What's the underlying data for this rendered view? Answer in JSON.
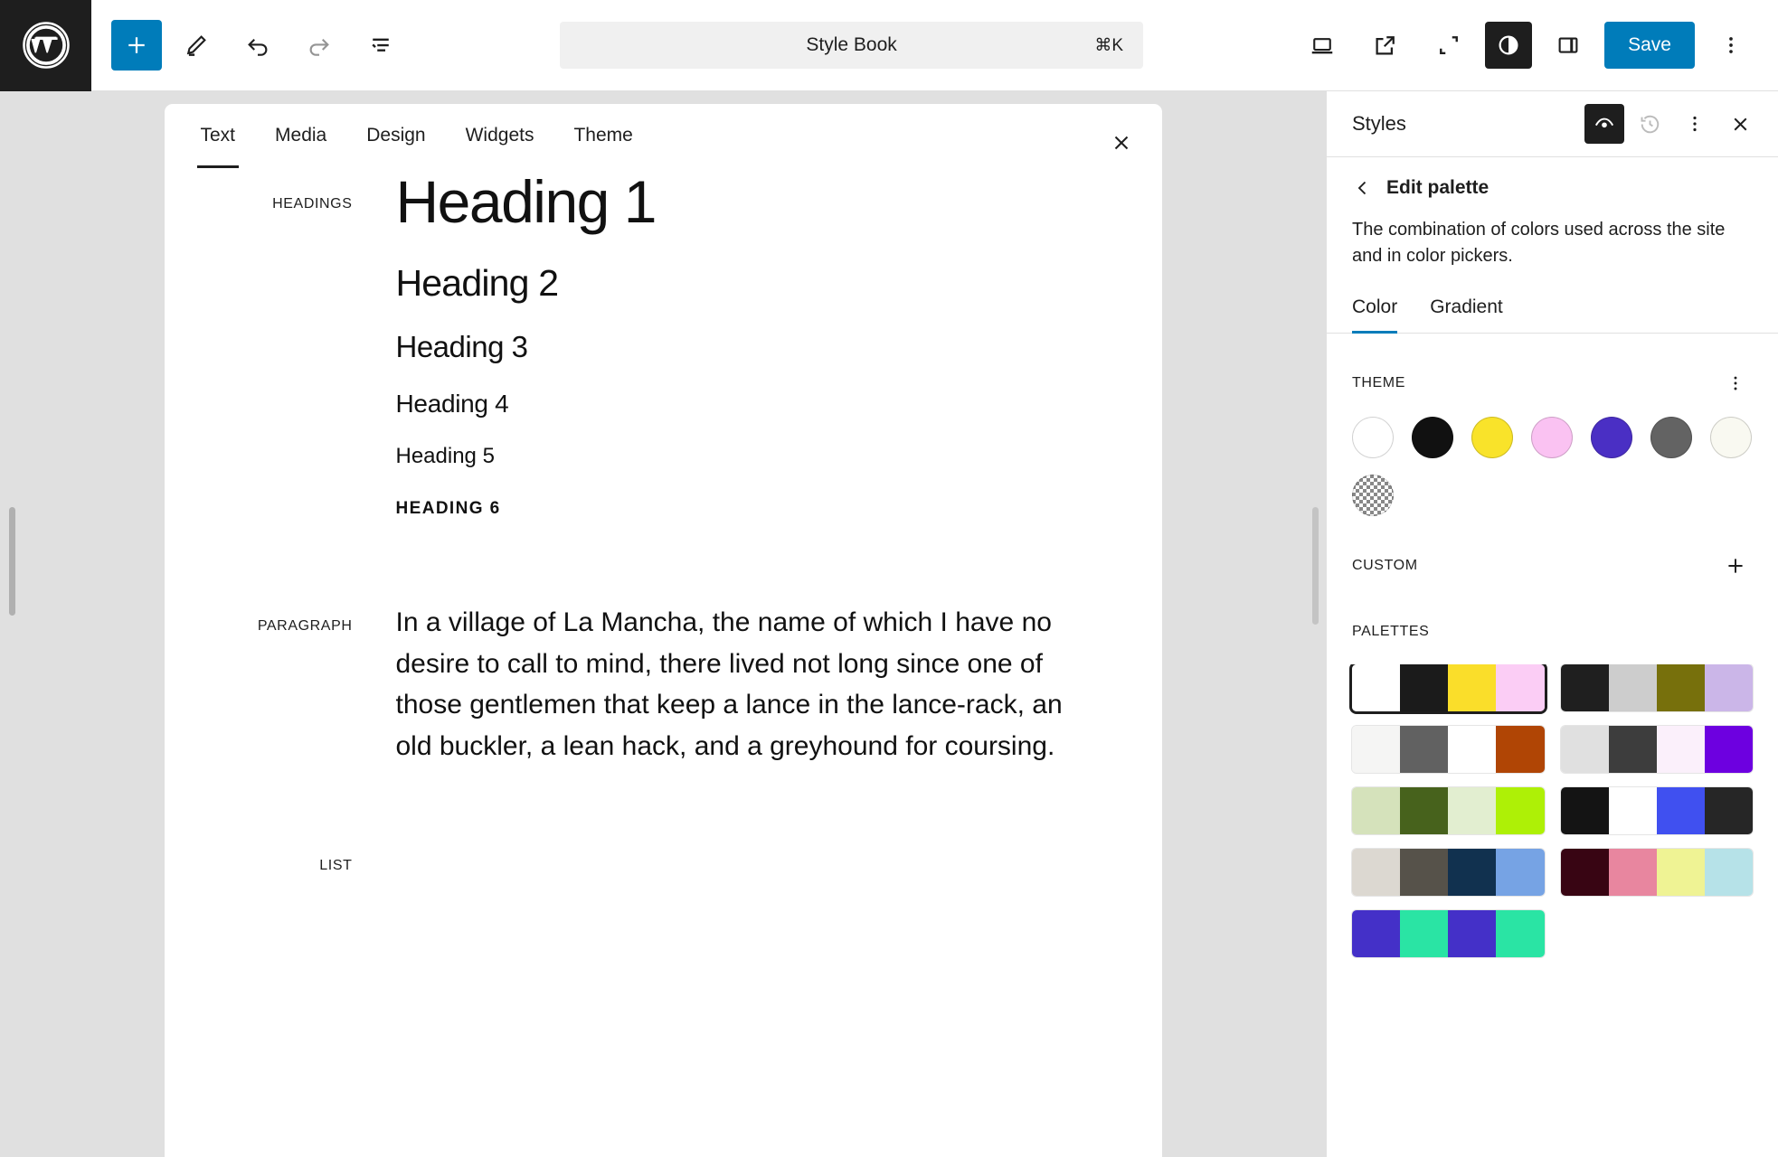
{
  "toolbar": {
    "logo": "wordpress-logo",
    "left_buttons": [
      {
        "name": "add-block-button",
        "icon": "plus-icon",
        "label": "Add block"
      },
      {
        "name": "edit-tool-button",
        "icon": "pencil-icon",
        "label": "Tools"
      },
      {
        "name": "undo-button",
        "icon": "undo-icon",
        "label": "Undo"
      },
      {
        "name": "redo-button",
        "icon": "redo-icon",
        "label": "Redo"
      },
      {
        "name": "list-view-button",
        "icon": "list-view-icon",
        "label": "Document Overview"
      }
    ],
    "command_bar": {
      "title": "Style Book",
      "shortcut": "⌘K"
    },
    "right_buttons": [
      {
        "name": "device-preview-button",
        "icon": "laptop-icon",
        "label": "View"
      },
      {
        "name": "view-site-button",
        "icon": "external-link-icon",
        "label": "View site"
      },
      {
        "name": "zoom-out-button",
        "icon": "expand-icon",
        "label": "Zoom out"
      },
      {
        "name": "styles-button",
        "icon": "contrast-circle-icon",
        "label": "Styles",
        "active": true
      },
      {
        "name": "settings-sidebar-button",
        "icon": "sidebar-panel-icon",
        "label": "Settings"
      }
    ],
    "save_label": "Save",
    "more_menu": "options-icon",
    "accent_color": "#007cba"
  },
  "stylebook": {
    "tabs": [
      {
        "label": "Text",
        "active": true
      },
      {
        "label": "Media",
        "active": false
      },
      {
        "label": "Design",
        "active": false
      },
      {
        "label": "Widgets",
        "active": false
      },
      {
        "label": "Theme",
        "active": false
      }
    ],
    "close_label": "Close Style Book",
    "sections": [
      {
        "label": "HEADINGS",
        "items": [
          "Heading 1",
          "Heading 2",
          "Heading 3",
          "Heading 4",
          "Heading 5",
          "Heading 6"
        ]
      },
      {
        "label": "PARAGRAPH",
        "text": "In a village of La Mancha, the name of which I have no desire to call to mind, there lived not long since one of those gentlemen that keep a lance in the lance-rack, an old buckler, a lean hack, and a greyhound for coursing."
      },
      {
        "label": "LIST"
      }
    ]
  },
  "sidebar": {
    "title": "Styles",
    "header_buttons": [
      {
        "name": "style-book-toggle",
        "icon": "eye-icon",
        "active": true
      },
      {
        "name": "revisions-button",
        "icon": "history-icon",
        "active": false
      },
      {
        "name": "styles-more-menu",
        "icon": "options-icon",
        "active": false
      },
      {
        "name": "close-styles-button",
        "icon": "close-icon",
        "active": false
      }
    ],
    "nav": {
      "back_icon": "chevron-left-icon",
      "title": "Edit palette"
    },
    "description": "The combination of colors used across the site and in color pickers.",
    "color_tabs": [
      {
        "label": "Color",
        "active": true
      },
      {
        "label": "Gradient",
        "active": false
      }
    ],
    "accent_color": "#007cba",
    "theme": {
      "title": "THEME",
      "menu_icon": "options-icon",
      "colors": [
        {
          "name": "Base",
          "hex": "#ffffff"
        },
        {
          "name": "Contrast",
          "hex": "#111111"
        },
        {
          "name": "Yellow",
          "hex": "#f9e32a"
        },
        {
          "name": "Pink",
          "hex": "#fac2f2"
        },
        {
          "name": "Purple",
          "hex": "#4a2fc4"
        },
        {
          "name": "Gray",
          "hex": "#636363"
        },
        {
          "name": "Cream",
          "hex": "#f9f9f1"
        },
        {
          "name": "Transparent",
          "hex": "transparent"
        }
      ]
    },
    "custom": {
      "title": "CUSTOM",
      "add_icon": "plus-icon"
    },
    "palettes": {
      "title": "PALETTES",
      "items": [
        {
          "name": "palette-1",
          "selected": true,
          "colors": [
            "#ffffff",
            "#1b1b1b",
            "#fade2a",
            "#fbcdf5"
          ]
        },
        {
          "name": "palette-2",
          "selected": false,
          "colors": [
            "#1f1f1f",
            "#cdcdcd",
            "#77700c",
            "#cbb6e8"
          ]
        },
        {
          "name": "palette-3",
          "selected": false,
          "colors": [
            "#f5f5f4",
            "#616161",
            "#ffffff",
            "#b04505"
          ]
        },
        {
          "name": "palette-4",
          "selected": false,
          "colors": [
            "#e0e0e0",
            "#3d3d3d",
            "#fbf0fb",
            "#6d00e0"
          ]
        },
        {
          "name": "palette-5",
          "selected": false,
          "colors": [
            "#d5e2bb",
            "#47621c",
            "#e2eed0",
            "#aef006"
          ]
        },
        {
          "name": "palette-6",
          "selected": false,
          "colors": [
            "#141414",
            "#ffffff",
            "#4050f0",
            "#262626"
          ]
        },
        {
          "name": "palette-7",
          "selected": false,
          "colors": [
            "#dcd8d1",
            "#56524a",
            "#11314f",
            "#76a3e4"
          ]
        },
        {
          "name": "palette-8",
          "selected": false,
          "colors": [
            "#380513",
            "#e8869f",
            "#eff394",
            "#b6e2e8"
          ]
        },
        {
          "name": "palette-9",
          "selected": false,
          "colors": [
            "#4430c8",
            "#2ae4a4",
            "#4430c8",
            "#2ae4a4"
          ]
        }
      ]
    }
  }
}
